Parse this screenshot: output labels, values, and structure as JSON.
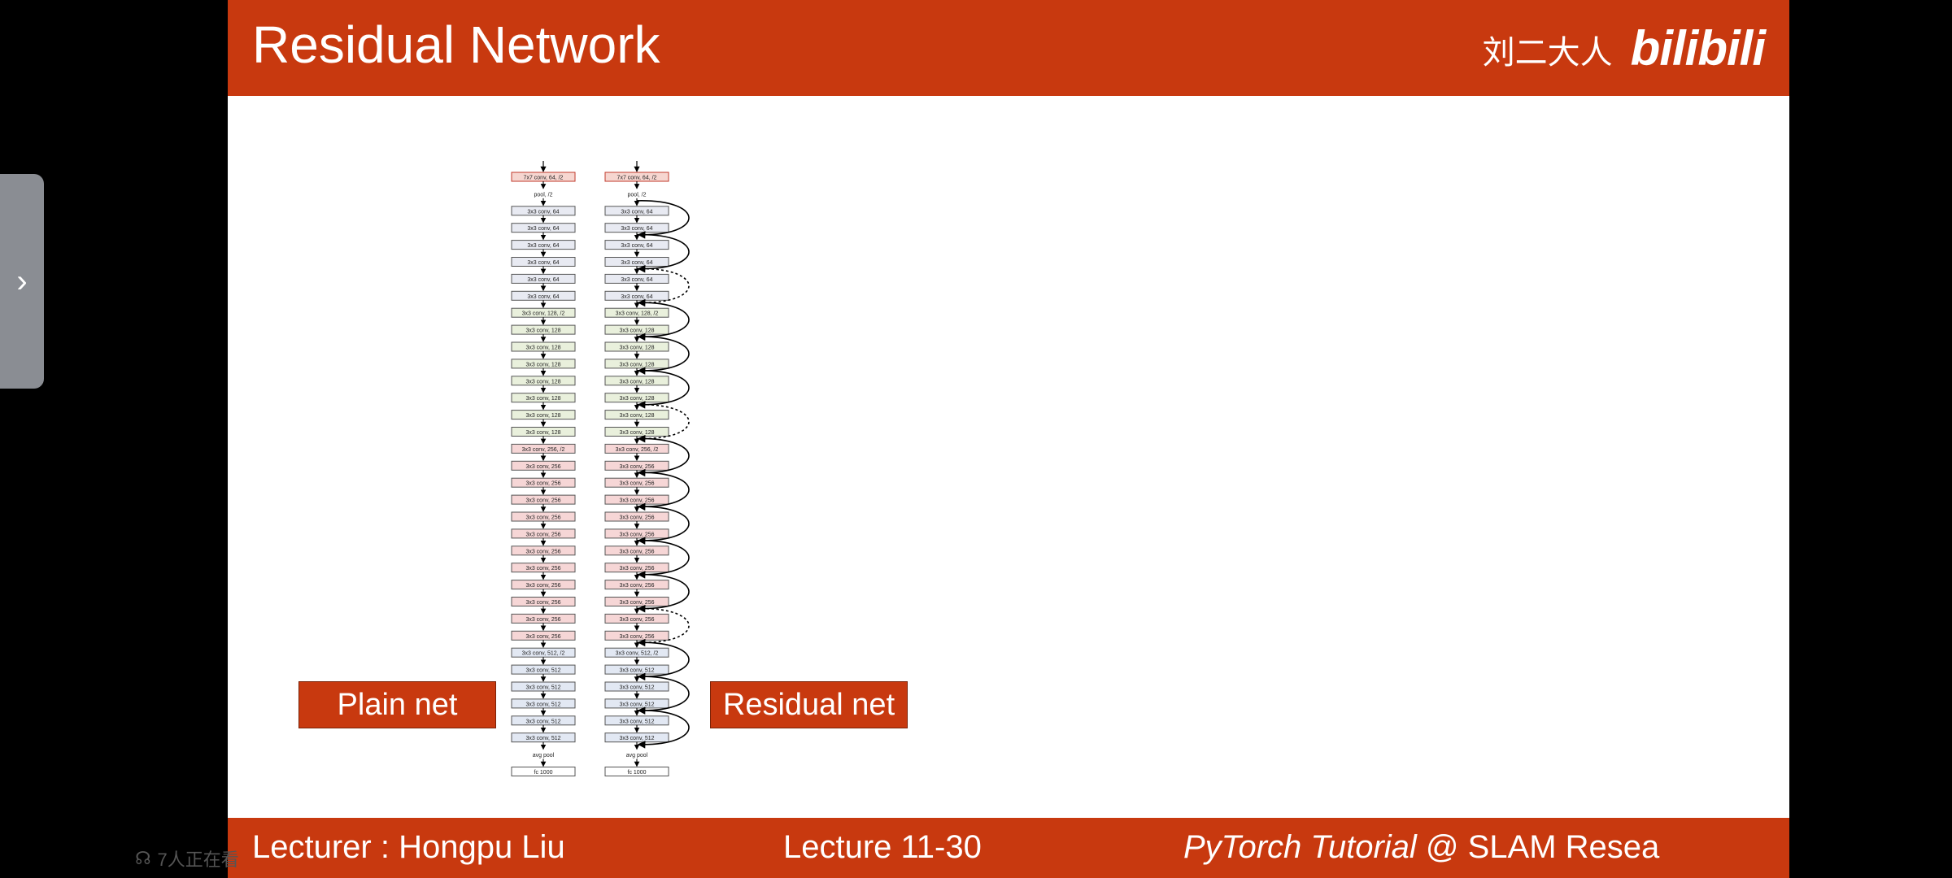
{
  "header": {
    "title": "Residual Network",
    "author": "刘二大人",
    "logo": "bilibili"
  },
  "footer": {
    "lecturer": "Lecturer : Hongpu Liu",
    "lecture": "Lecture 11-30",
    "tutorial_italic": "PyTorch Tutorial",
    "tutorial_rest": " @ SLAM Resea"
  },
  "labels": {
    "plain": "Plain net",
    "residual": "Residual net"
  },
  "diagram": {
    "layers": [
      {
        "text": "7x7 conv, 64, /2",
        "stage": "stem"
      },
      {
        "text": "pool, /2",
        "stage": "pool"
      },
      {
        "text": "3x3 conv, 64",
        "stage": "s64"
      },
      {
        "text": "3x3 conv, 64",
        "stage": "s64"
      },
      {
        "text": "3x3 conv, 64",
        "stage": "s64"
      },
      {
        "text": "3x3 conv, 64",
        "stage": "s64"
      },
      {
        "text": "3x3 conv, 64",
        "stage": "s64"
      },
      {
        "text": "3x3 conv, 64",
        "stage": "s64"
      },
      {
        "text": "3x3 conv, 128, /2",
        "stage": "s128"
      },
      {
        "text": "3x3 conv, 128",
        "stage": "s128"
      },
      {
        "text": "3x3 conv, 128",
        "stage": "s128"
      },
      {
        "text": "3x3 conv, 128",
        "stage": "s128"
      },
      {
        "text": "3x3 conv, 128",
        "stage": "s128"
      },
      {
        "text": "3x3 conv, 128",
        "stage": "s128"
      },
      {
        "text": "3x3 conv, 128",
        "stage": "s128"
      },
      {
        "text": "3x3 conv, 128",
        "stage": "s128"
      },
      {
        "text": "3x3 conv, 256, /2",
        "stage": "s256"
      },
      {
        "text": "3x3 conv, 256",
        "stage": "s256"
      },
      {
        "text": "3x3 conv, 256",
        "stage": "s256"
      },
      {
        "text": "3x3 conv, 256",
        "stage": "s256"
      },
      {
        "text": "3x3 conv, 256",
        "stage": "s256"
      },
      {
        "text": "3x3 conv, 256",
        "stage": "s256"
      },
      {
        "text": "3x3 conv, 256",
        "stage": "s256"
      },
      {
        "text": "3x3 conv, 256",
        "stage": "s256"
      },
      {
        "text": "3x3 conv, 256",
        "stage": "s256"
      },
      {
        "text": "3x3 conv, 256",
        "stage": "s256"
      },
      {
        "text": "3x3 conv, 256",
        "stage": "s256"
      },
      {
        "text": "3x3 conv, 256",
        "stage": "s256"
      },
      {
        "text": "3x3 conv, 512, /2",
        "stage": "s512"
      },
      {
        "text": "3x3 conv, 512",
        "stage": "s512"
      },
      {
        "text": "3x3 conv, 512",
        "stage": "s512"
      },
      {
        "text": "3x3 conv, 512",
        "stage": "s512"
      },
      {
        "text": "3x3 conv, 512",
        "stage": "s512"
      },
      {
        "text": "3x3 conv, 512",
        "stage": "s512"
      },
      {
        "text": "avg pool",
        "stage": "pool"
      },
      {
        "text": "fc 1000",
        "stage": "fc"
      }
    ],
    "stage_colors": {
      "stem": "#f6d6d0",
      "s64": "#e8eaf2",
      "s128": "#e9f0dc",
      "s256": "#f6d6d6",
      "s512": "#e2e8f3",
      "fc": "#ffffff"
    },
    "dashed_shortcut_targets": [
      8,
      16,
      28
    ]
  },
  "overlay": {
    "viewers": "7人正在看"
  },
  "colors": {
    "accent": "#c8390f"
  }
}
